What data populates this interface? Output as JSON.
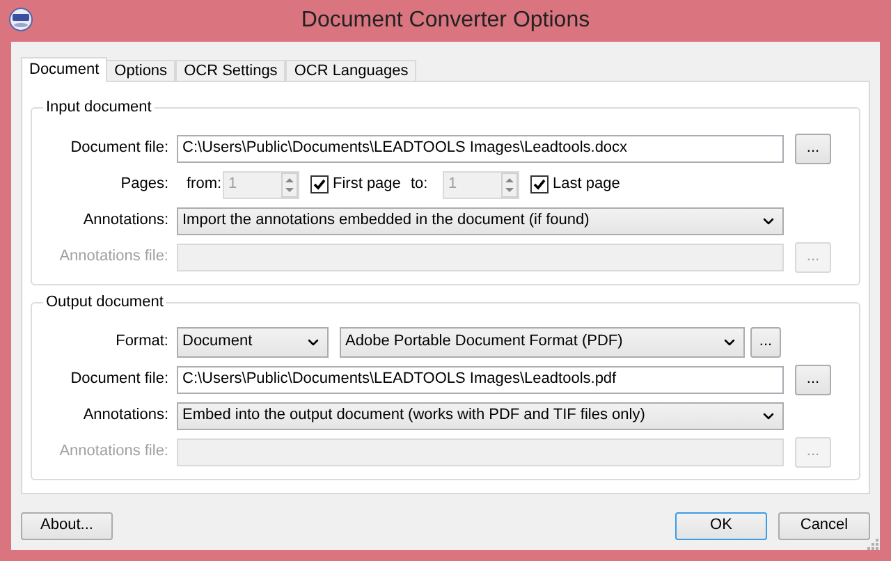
{
  "window": {
    "title": "Document Converter Options"
  },
  "tabs": [
    {
      "label": "Document",
      "selected": true
    },
    {
      "label": "Options",
      "selected": false
    },
    {
      "label": "OCR Settings",
      "selected": false
    },
    {
      "label": "OCR Languages",
      "selected": false
    }
  ],
  "input_document": {
    "title": "Input document",
    "document_file": {
      "label": "Document file:",
      "value": "C:\\Users\\Public\\Documents\\LEADTOOLS Images\\Leadtools.docx",
      "browse": "...",
      "disabled": false
    },
    "pages": {
      "label": "Pages:",
      "from": {
        "label": "from:",
        "value": "1",
        "disabled": true
      },
      "first_page": {
        "label": "First page",
        "checked": true
      },
      "to": {
        "label": "to:",
        "value": "1",
        "disabled": true
      },
      "last_page": {
        "label": "Last page",
        "checked": true
      }
    },
    "annotations": {
      "label": "Annotations:",
      "value": "Import the annotations embedded in the document (if found)"
    },
    "annotations_file": {
      "label": "Annotations file:",
      "browse": "...",
      "disabled": true
    }
  },
  "output_document": {
    "title": "Output document",
    "format": {
      "label": "Format:",
      "type": "Document",
      "value": "Adobe Portable Document Format (PDF)",
      "browse": "..."
    },
    "document_file": {
      "label": "Document file:",
      "value": "C:\\Users\\Public\\Documents\\LEADTOOLS Images\\Leadtools.pdf",
      "browse": "...",
      "disabled": false
    },
    "annotations": {
      "label": "Annotations:",
      "value": "Embed into the output document (works with PDF and TIF files only)"
    },
    "annotations_file": {
      "label": "Annotations file:",
      "browse": "...",
      "disabled": true
    }
  },
  "buttons": [
    {
      "label": "About...",
      "default": false
    },
    {
      "label": "OK",
      "default": true
    },
    {
      "label": "Cancel",
      "default": false
    }
  ]
}
